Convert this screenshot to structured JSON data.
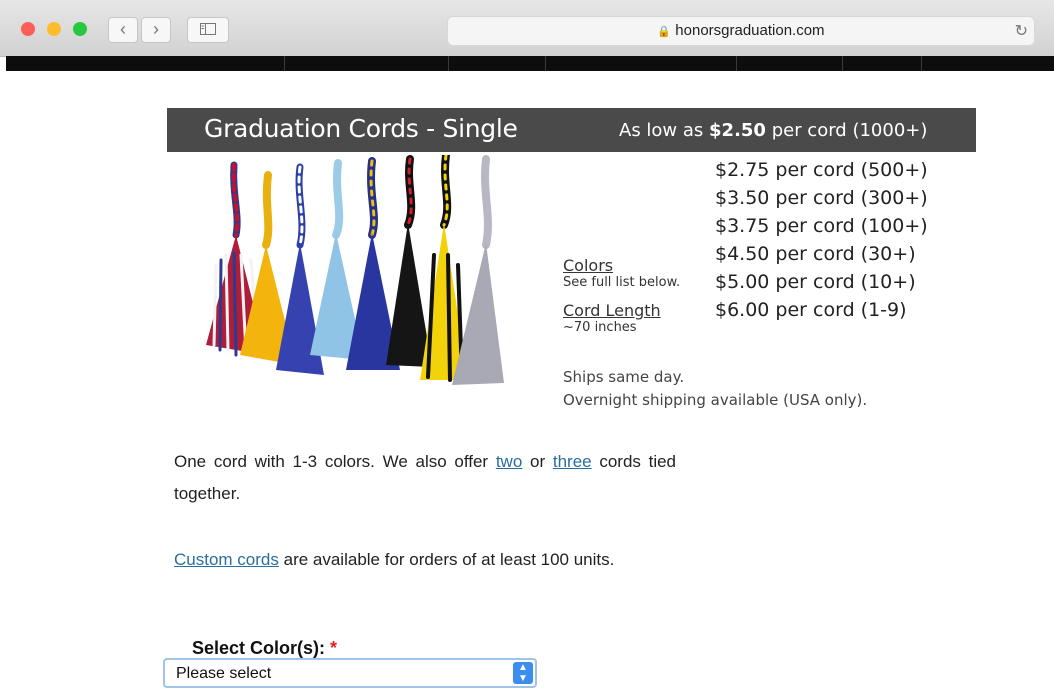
{
  "browser": {
    "url": "honorsgraduation.com",
    "back_icon": "chevron-left-icon",
    "forward_icon": "chevron-right-icon",
    "sidebar_icon": "sidebar-icon",
    "lock_icon": "lock-icon",
    "reload_icon": "reload-icon",
    "back_glyph": "‹",
    "forward_glyph": "›",
    "lock_glyph": "🔒",
    "reload_glyph": "↻"
  },
  "banner": {
    "title": "Graduation Cords - Single",
    "price_prefix": "As low as",
    "price_amount": "$2.50",
    "price_suffix": "per cord (1000+)"
  },
  "pricing_tiers": [
    "$2.75 per cord (500+)",
    "$3.50 per cord (300+)",
    "$3.75 per cord (100+)",
    "$4.50 per cord (30+)",
    "$5.00 per cord (10+)",
    "$6.00 per cord (1-9)"
  ],
  "details": {
    "colors_heading": "Colors",
    "colors_note": "See full list below.",
    "length_heading": "Cord Length",
    "length_note": "~70 inches",
    "ships_line1": "Ships same day.",
    "ships_line2": "Overnight shipping available (USA only)."
  },
  "description": {
    "p1_a": "One cord with 1-3 colors. We also offer",
    "link_two": "two",
    "p1_or": "or",
    "link_three": "three",
    "p1_b": "cords tied together.",
    "link_custom": "Custom cords",
    "p2_b": "are available for orders of at least 100 units."
  },
  "color_select": {
    "label": "Select Color(s):",
    "required_mark": "*",
    "value": "Please select"
  },
  "colors": {
    "banner_bg": "#4a4a4a",
    "link": "#2a6f9e",
    "select_border": "#9ec4ea",
    "select_arrow": "#3b8ef0"
  }
}
